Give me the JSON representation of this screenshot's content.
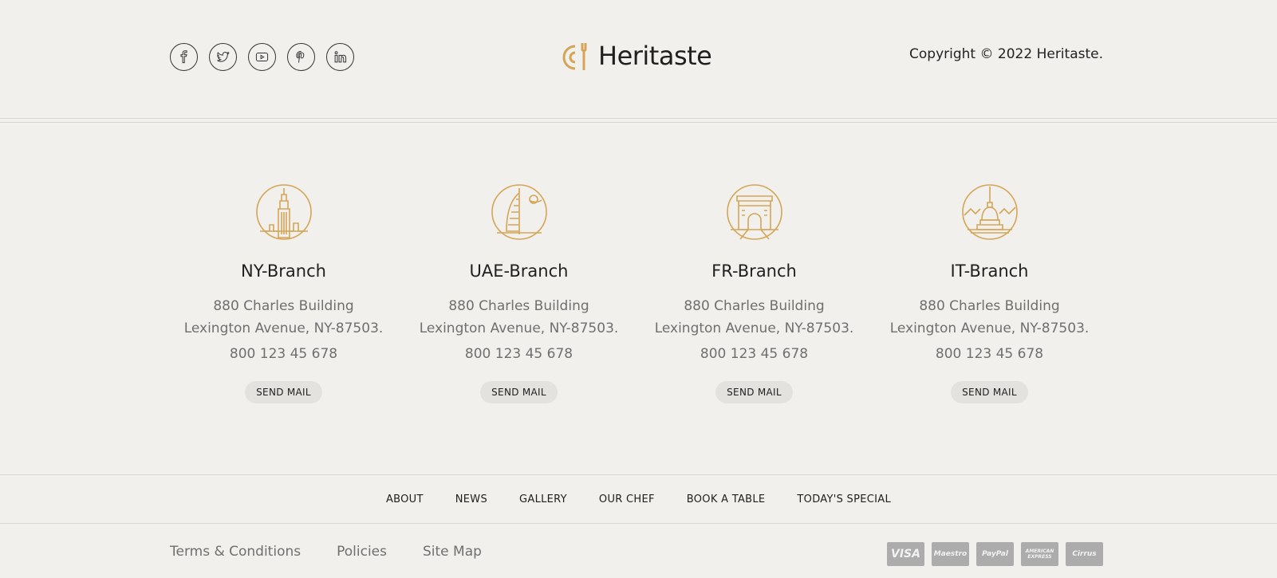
{
  "social": [
    {
      "name": "facebook-icon"
    },
    {
      "name": "twitter-icon"
    },
    {
      "name": "youtube-icon"
    },
    {
      "name": "pinterest-icon"
    },
    {
      "name": "linkedin-icon"
    }
  ],
  "brand": {
    "name": "Heritaste",
    "accent": "#d4a556"
  },
  "copyright": "Copyright © 2022 Heritaste.",
  "branches": [
    {
      "name": "NY-Branch",
      "icon": "empire-state-icon",
      "address1": "880 Charles Building",
      "address2": "Lexington Avenue, NY-87503.",
      "phone": "800 123 45 678",
      "button": "SEND MAIL"
    },
    {
      "name": "UAE-Branch",
      "icon": "burj-al-arab-icon",
      "address1": "880 Charles Building",
      "address2": "Lexington Avenue, NY-87503.",
      "phone": "800 123 45 678",
      "button": "SEND MAIL"
    },
    {
      "name": "FR-Branch",
      "icon": "arc-de-triomphe-icon",
      "address1": "880 Charles Building",
      "address2": "Lexington Avenue, NY-87503.",
      "phone": "800 123 45 678",
      "button": "SEND MAIL"
    },
    {
      "name": "IT-Branch",
      "icon": "mole-antonelliana-icon",
      "address1": "880 Charles Building",
      "address2": "Lexington Avenue, NY-87503.",
      "phone": "800 123 45 678",
      "button": "SEND MAIL"
    }
  ],
  "nav": [
    "ABOUT",
    "NEWS",
    "GALLERY",
    "OUR CHEF",
    "BOOK A TABLE",
    "TODAY'S SPECIAL"
  ],
  "legal": [
    "Terms & Conditions",
    "Policies",
    "Site Map"
  ],
  "payments": [
    "VISA",
    "Maestro",
    "PayPal",
    "AMERICAN EXPRESS",
    "Cirrus"
  ]
}
